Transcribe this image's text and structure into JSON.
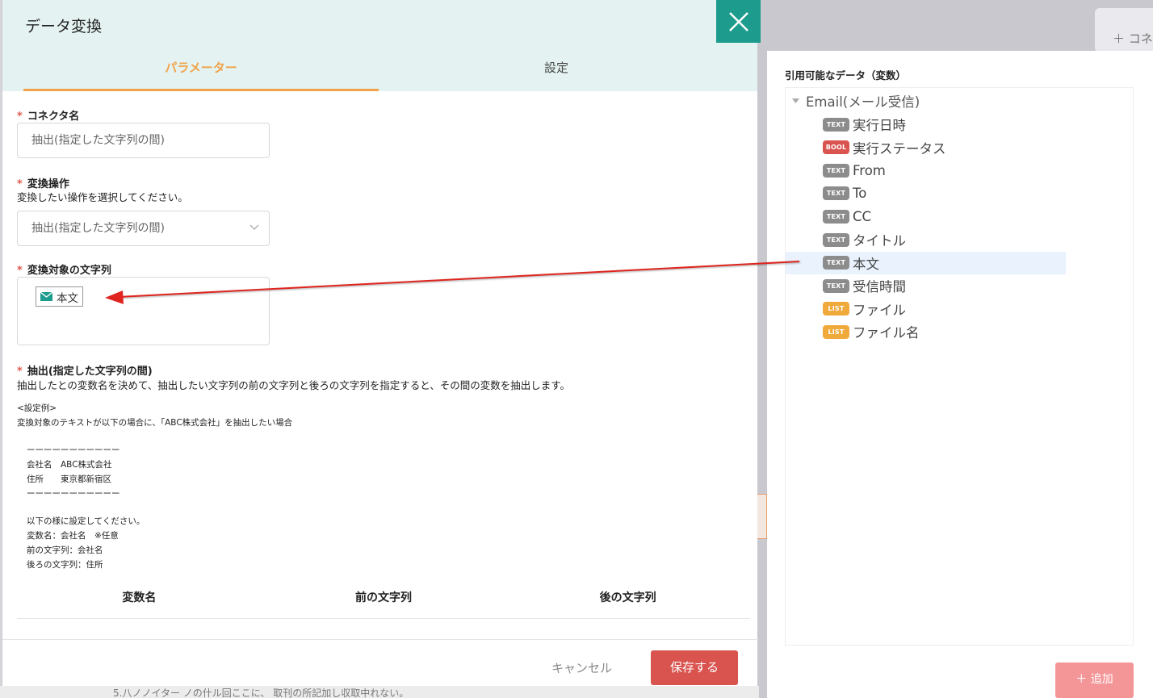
{
  "background": {
    "card_label": "＋ コネ",
    "strip_text": "5.八ノノイター ノの什ル回ここに、 取刊の所記加し収取中れない。"
  },
  "modal": {
    "title": "データ変換",
    "tabs": [
      {
        "label": "パラメーター",
        "active": true
      },
      {
        "label": "設定",
        "active": false
      }
    ],
    "connector_name": {
      "label": "コネクタ名",
      "value": "抽出(指定した文字列の間)"
    },
    "operation": {
      "label": "変換操作",
      "help": "変換したい操作を選択してください。",
      "selected": "抽出(指定した文字列の間)"
    },
    "target": {
      "label": "変換対象の文字列",
      "chip_label": "本文"
    },
    "extract": {
      "label": "抽出(指定した文字列の間)",
      "help": "抽出したとの変数名を決めて、抽出したい文字列の前の文字列と後ろの文字列を指定すると、その間の変数を抽出します。",
      "example_title": "<設定例>",
      "example_intro": "変換対象のテキストが以下の場合に、「ABC株式会社」を抽出したい場合",
      "example_block": "ーーーーーーーーーーー\n会社名　ABC株式会社\n住所　　東京都新宿区\nーーーーーーーーーーー",
      "example_settings": "以下の様に設定してください。\n変数名：会社名　※任意\n前の文字列：会社名\n後ろの文字列：住所"
    },
    "table_headers": [
      "変数名",
      "前の文字列",
      "後の文字列"
    ],
    "cancel_label": "キャンセル",
    "save_label": "保存する"
  },
  "variables": {
    "title": "引用可能なデータ（変数）",
    "root": "Email(メール受信)",
    "items": [
      {
        "badge": "TEXT",
        "label": "実行日時"
      },
      {
        "badge": "BOOL",
        "label": "実行ステータス"
      },
      {
        "badge": "TEXT",
        "label": "From"
      },
      {
        "badge": "TEXT",
        "label": "To"
      },
      {
        "badge": "TEXT",
        "label": "CC"
      },
      {
        "badge": "TEXT",
        "label": "タイトル"
      },
      {
        "badge": "TEXT",
        "label": "本文",
        "selected": true
      },
      {
        "badge": "TEXT",
        "label": "受信時間"
      },
      {
        "badge": "LIST",
        "label": "ファイル"
      },
      {
        "badge": "LIST",
        "label": "ファイル名"
      }
    ],
    "add_label": "＋ 追加"
  },
  "colors": {
    "accent_teal": "#1d9c8e",
    "tab_active": "#f0a24a",
    "save_button": "#d9534f",
    "badge_text": "#8c8c8c",
    "badge_bool": "#d9534f",
    "badge_list": "#f0a93b",
    "arrow": "#e0241e"
  }
}
